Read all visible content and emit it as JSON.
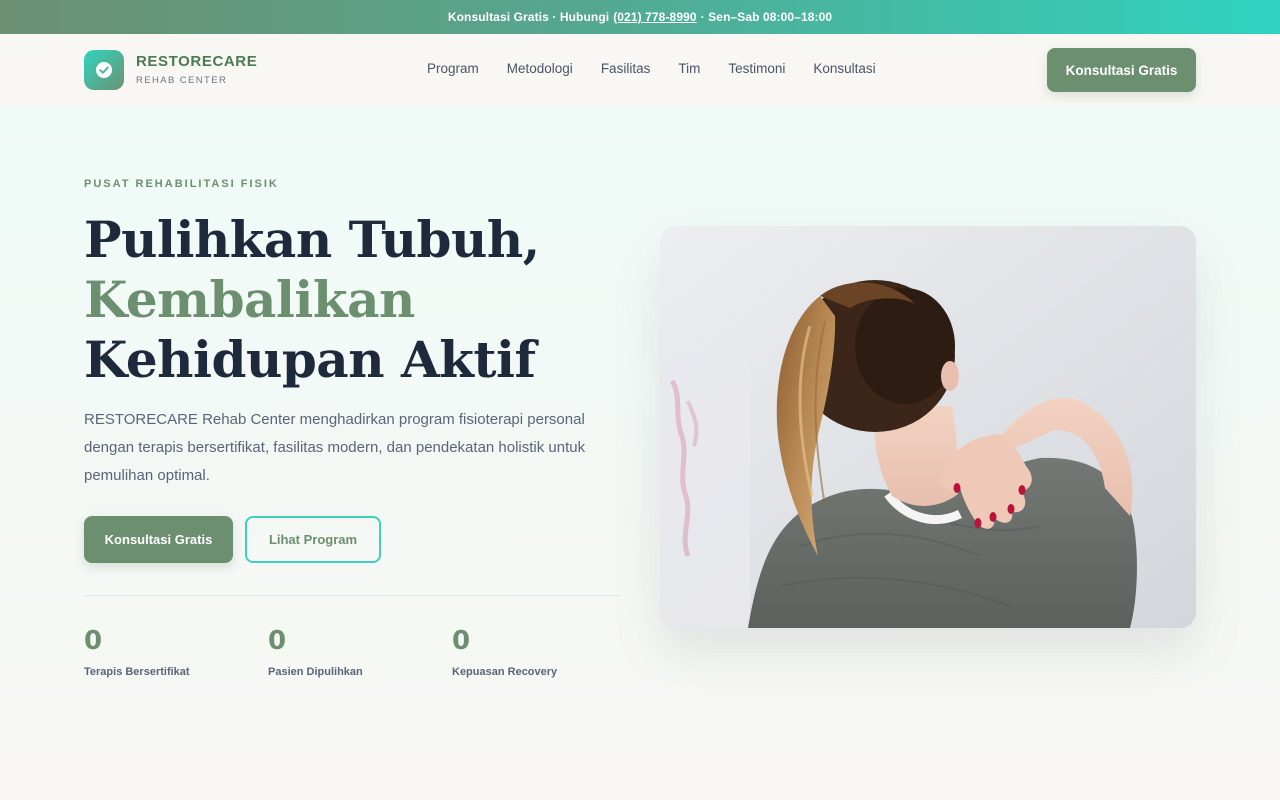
{
  "topbar": {
    "text_before": "Konsultasi Gratis · Hubungi",
    "phone": "(021) 778-8990",
    "text_after": "· Sen–Sab 08:00–18:00"
  },
  "brand": {
    "name": "RESTORECARE",
    "subtitle": "REHAB CENTER",
    "icon": "check-circle-icon"
  },
  "nav": {
    "items": [
      {
        "label": "Program"
      },
      {
        "label": "Metodologi"
      },
      {
        "label": "Fasilitas"
      },
      {
        "label": "Tim"
      },
      {
        "label": "Testimoni"
      },
      {
        "label": "Konsultasi"
      }
    ],
    "cta_label": "Konsultasi Gratis"
  },
  "hero": {
    "eyebrow": "PUSAT REHABILITASI FISIK",
    "headline_line1": "Pulihkan Tubuh,",
    "headline_line2": "Kembalikan",
    "headline_line3": "Kehidupan Aktif",
    "lead": "RESTORECARE Rehab Center menghadirkan program fisioterapi personal dengan terapis bersertifikat, fasilitas modern, dan pendekatan holistik untuk pemulihan optimal.",
    "primary_cta": "Konsultasi Gratis",
    "secondary_cta": "Lihat Program",
    "stats": [
      {
        "value": "0",
        "label": "Terapis Bersertifikat"
      },
      {
        "value": "0",
        "label": "Pasien Dipulihkan"
      },
      {
        "value": "0",
        "label": "Kepuasan Recovery"
      }
    ]
  },
  "colors": {
    "brand_green": "#6b8f6f",
    "accent_teal": "#2fd3c0",
    "heading_navy": "#1e2a3b",
    "body_text": "#5a6678"
  }
}
